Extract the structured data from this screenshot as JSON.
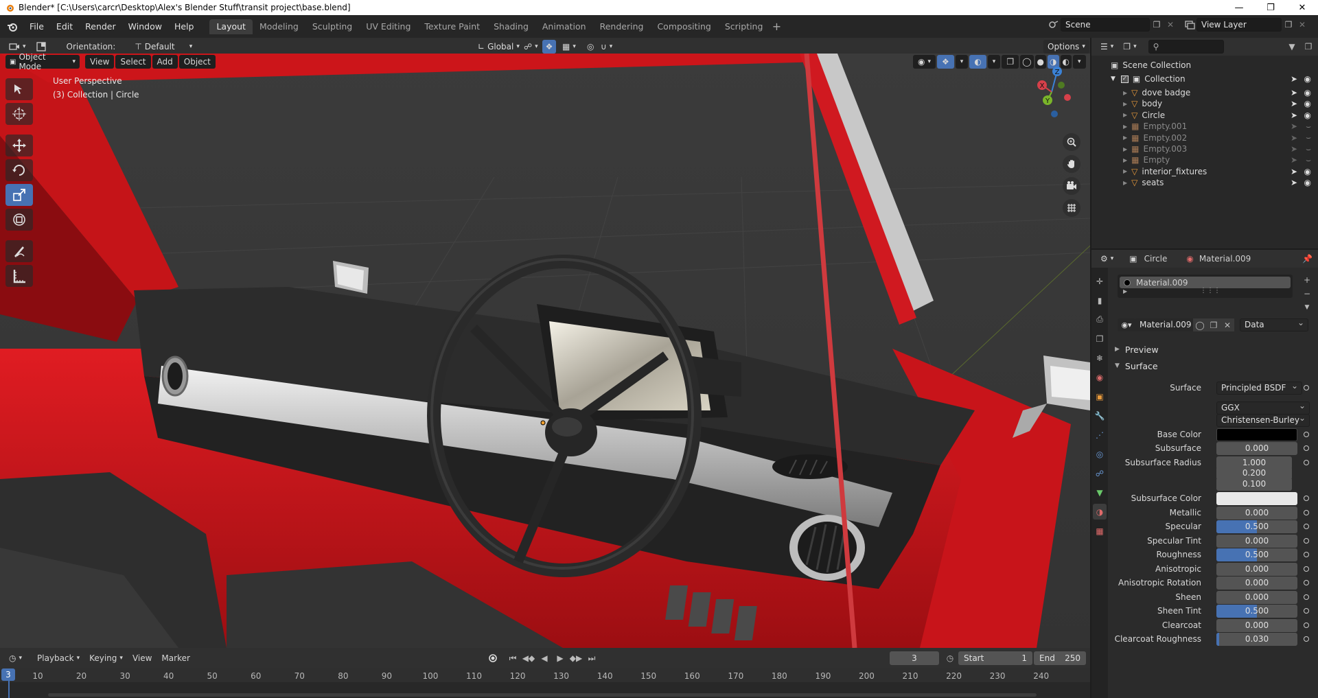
{
  "window": {
    "title": "Blender* [C:\\Users\\carcr\\Desktop\\Alex's Blender Stuff\\transit project\\base.blend]"
  },
  "menu": [
    "File",
    "Edit",
    "Render",
    "Window",
    "Help"
  ],
  "workspaces": [
    "Layout",
    "Modeling",
    "Sculpting",
    "UV Editing",
    "Texture Paint",
    "Shading",
    "Animation",
    "Rendering",
    "Compositing",
    "Scripting"
  ],
  "active_workspace": "Layout",
  "scene": {
    "name": "Scene",
    "view_layer": "View Layer"
  },
  "viewport_header": {
    "orientation_label": "Orientation:",
    "orientation_value": "Default",
    "transform_space": "Global",
    "options": "Options",
    "mode": "Object Mode",
    "menus": [
      "View",
      "Select",
      "Add",
      "Object"
    ]
  },
  "viewport_info": {
    "line1": "User Perspective",
    "line2": "(3) Collection | Circle"
  },
  "gizmo": {
    "x": "X",
    "y": "Y",
    "z": "Z"
  },
  "outliner": {
    "scene_collection": "Scene Collection",
    "collection": "Collection",
    "items": [
      {
        "name": "dove badge",
        "dim": false
      },
      {
        "name": "body",
        "dim": false
      },
      {
        "name": "Circle",
        "dim": false
      },
      {
        "name": "Empty.001",
        "dim": true
      },
      {
        "name": "Empty.002",
        "dim": true
      },
      {
        "name": "Empty.003",
        "dim": true
      },
      {
        "name": "Empty",
        "dim": true
      },
      {
        "name": "interior_fixtures",
        "dim": false
      },
      {
        "name": "seats",
        "dim": false
      }
    ]
  },
  "properties": {
    "object": "Circle",
    "material": "Material.009",
    "slot": "Material.009",
    "material_field": "Material.009",
    "link": "Data",
    "preview": "Preview",
    "surface_section": "Surface",
    "surface_label": "Surface",
    "surface_value": "Principled BSDF",
    "distribution": "GGX",
    "subsurface_method": "Christensen-Burley",
    "base_color_label": "Base Color",
    "base_color": "#000000",
    "subsurface_color_label": "Subsurface Color",
    "subsurface_color": "#e8e8e8",
    "params": [
      {
        "label": "Subsurface",
        "value": "0.000",
        "fraction": 0
      },
      {
        "label": "Subsurface Radius",
        "value": "1.000",
        "fraction": 0
      },
      {
        "label": "",
        "value": "0.200",
        "fraction": 0
      },
      {
        "label": "",
        "value": "0.100",
        "fraction": 0
      },
      {
        "label": "Metallic",
        "value": "0.000",
        "fraction": 0
      },
      {
        "label": "Specular",
        "value": "0.500",
        "fraction": 0.5
      },
      {
        "label": "Specular Tint",
        "value": "0.000",
        "fraction": 0
      },
      {
        "label": "Roughness",
        "value": "0.500",
        "fraction": 0.5
      },
      {
        "label": "Anisotropic",
        "value": "0.000",
        "fraction": 0
      },
      {
        "label": "Anisotropic Rotation",
        "value": "0.000",
        "fraction": 0
      },
      {
        "label": "Sheen",
        "value": "0.000",
        "fraction": 0
      },
      {
        "label": "Sheen Tint",
        "value": "0.500",
        "fraction": 0.5
      },
      {
        "label": "Clearcoat",
        "value": "0.000",
        "fraction": 0
      },
      {
        "label": "Clearcoat Roughness",
        "value": "0.030",
        "fraction": 0.03
      }
    ]
  },
  "timeline": {
    "menus": [
      "Playback",
      "Keying",
      "View",
      "Marker"
    ],
    "current_frame": "3",
    "start_label": "Start",
    "start": "1",
    "end_label": "End",
    "end": "250",
    "ticks": [
      "10",
      "20",
      "30",
      "40",
      "50",
      "60",
      "70",
      "80",
      "90",
      "100",
      "110",
      "120",
      "130",
      "140",
      "150",
      "160",
      "170",
      "180",
      "190",
      "200",
      "210",
      "220",
      "230",
      "240"
    ],
    "playhead": "3"
  },
  "colors": {
    "accent": "#4772b3",
    "active_tab": "#3d3d3d",
    "car_red": "#d0141a"
  }
}
